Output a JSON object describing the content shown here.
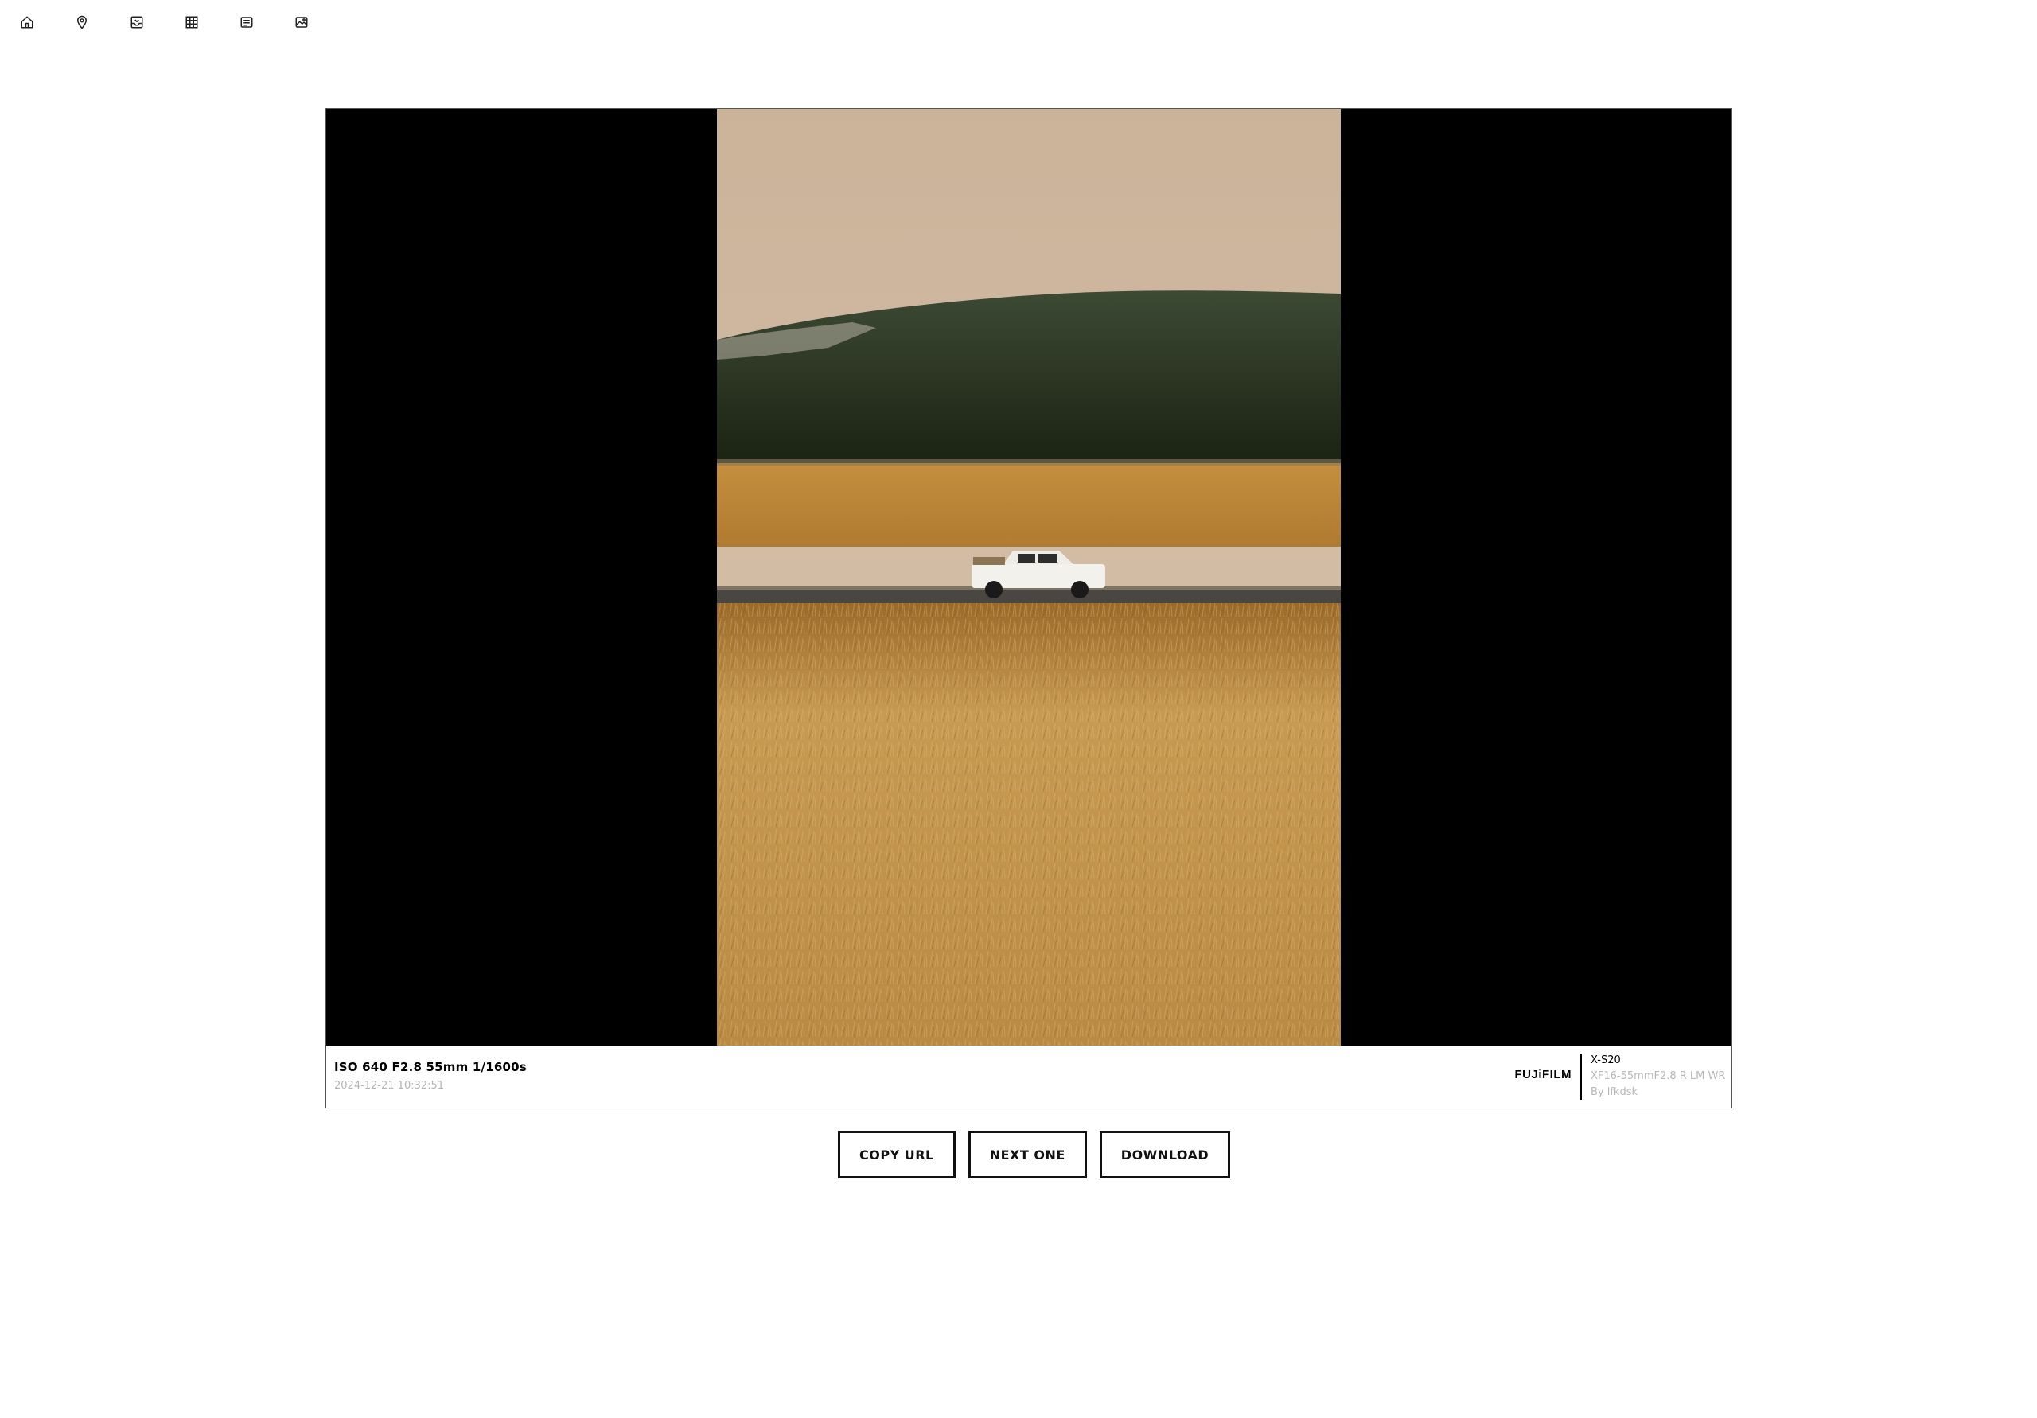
{
  "nav": {
    "icons": [
      "home-icon",
      "map-pin-icon",
      "inbox-icon",
      "grid-icon",
      "list-icon",
      "image-icon"
    ]
  },
  "photo": {
    "exif": "ISO 640 F2.8 55mm 1/1600s",
    "datetime": "2024-12-21 10:32:51",
    "brand": "FUJiFILM",
    "camera_model": "X-S20",
    "lens": "XF16-55mmF2.8 R LM WR",
    "author": "By lfkdsk"
  },
  "actions": {
    "copy_url": "COPY URL",
    "next_one": "NEXT ONE",
    "download": "DOWNLOAD"
  },
  "colors": {
    "frame_border": "#555555",
    "viewer_bg": "#000000",
    "muted_text": "#b5b5b5"
  }
}
